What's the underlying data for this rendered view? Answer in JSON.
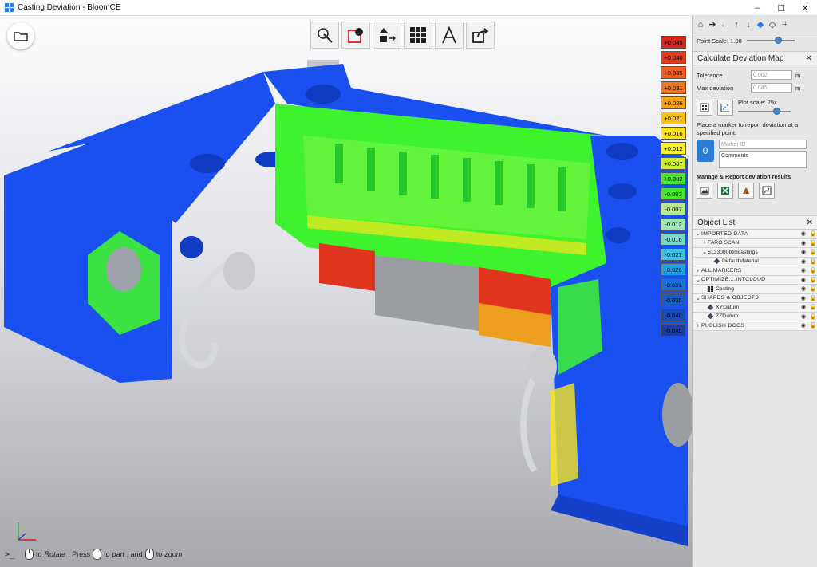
{
  "window": {
    "title": "Casting Deviation - BloomCE",
    "minimize_glyph": "–",
    "maximize_glyph": "☐",
    "close_glyph": "✕"
  },
  "toolbar": {
    "tools": [
      "select-arrow-icon",
      "clip-box-icon",
      "transform-icon",
      "grid-icon",
      "measure-icon",
      "export-icon"
    ]
  },
  "legend": {
    "values": [
      "+0.045",
      "+0.040",
      "+0.035",
      "+0.031",
      "+0.026",
      "+0.021",
      "+0.016",
      "+0.012",
      "+0.007",
      "+0.002",
      "-0.002",
      "-0.007",
      "-0.012",
      "-0.016",
      "-0.021",
      "-0.026",
      "-0.031",
      "-0.035",
      "-0.040",
      "-0.045"
    ],
    "colors": [
      "#d42a1e",
      "#e83a1f",
      "#f25a1e",
      "#f2741c",
      "#f8a21a",
      "#fbc214",
      "#fde21a",
      "#f8f027",
      "#cdf227",
      "#45e82a",
      "#45e82a",
      "#b6ec8d",
      "#9fe6b6",
      "#75d8c8",
      "#3fc1ea",
      "#1ea0e6",
      "#1b71d8",
      "#1a5dc5",
      "#194bb4",
      "#1b3ca3"
    ]
  },
  "nav": {
    "icons": [
      "home-icon",
      "arrow-right-icon",
      "arrow-left-icon",
      "arrow-up-icon",
      "arrow-down-icon",
      "cube-solid-icon",
      "cube-wire-icon",
      "crop-icon"
    ]
  },
  "panel": {
    "point_scale_label": "Point Scale: 1.00",
    "point_scale_fraction": 0.7,
    "calc_title": "Calculate Deviation Map",
    "calc_close": "✕",
    "tolerance_label": "Tolerance",
    "tolerance_value": "0.002",
    "tolerance_unit": "m",
    "maxdev_label": "Max deviation",
    "maxdev_value": "0.045",
    "maxdev_unit": "m",
    "plot_scale_label": "Plot scale: 25x",
    "plot_scale_fraction": 0.78,
    "marker_note": "Place a marker to report deviation at a specified point.",
    "marker_id_placeholder": "Marker ID",
    "comments_placeholder": "Comments",
    "manage_title": "Manage & Report deviation results",
    "report_icons": [
      "image-export-icon",
      "excel-export-icon",
      "pdf-export-icon",
      "chart-export-icon"
    ]
  },
  "object_list": {
    "title": "Object List",
    "close": "✕",
    "rows": [
      {
        "name": "IMPORTED DATA",
        "chev": "⌄",
        "indent": 0,
        "lock": "🔓"
      },
      {
        "name": "FARO SCAN",
        "chev": "›",
        "indent": 1,
        "lock": "🔓"
      },
      {
        "name": "6133080btmcastings",
        "chev": "⌄",
        "indent": 1,
        "lock": "🔒"
      },
      {
        "name": "DefaultMaterial",
        "chev": "",
        "indent": 2,
        "lock": "🔒"
      },
      {
        "name": "ALL MARKERS",
        "chev": "›",
        "indent": 0,
        "lock": "🔓"
      },
      {
        "name": "OPTIMIZE....INTCLOUD",
        "chev": "⌄",
        "indent": 0,
        "lock": "🔓"
      },
      {
        "name": "Casting",
        "chev": "",
        "indent": 1,
        "lock": "🔓"
      },
      {
        "name": "SHAPES & OBJECTS",
        "chev": "⌄",
        "indent": 0,
        "lock": "🔓"
      },
      {
        "name": "XYDatum",
        "chev": "",
        "indent": 1,
        "lock": "🔓"
      },
      {
        "name": "ZZDatum",
        "chev": "",
        "indent": 1,
        "lock": "🔓"
      },
      {
        "name": "PUBLISH DOCS",
        "chev": "›",
        "indent": 0,
        "lock": "🔓"
      }
    ]
  },
  "status": {
    "prompt": ">_",
    "t1": "to",
    "rotate": "Rotate",
    "t2": ", Press",
    "t3": "to",
    "pan": "pan",
    "t4": ", and",
    "t5": "to",
    "zoom": "zoom"
  },
  "colors": {
    "mesh_blue": "#1a4ff0",
    "mesh_green": "#3ef32e",
    "mesh_yellow": "#f7e51e",
    "mesh_red": "#e0361f",
    "panel_bg": "#e6e6e6",
    "accent": "#2a7dd6"
  }
}
